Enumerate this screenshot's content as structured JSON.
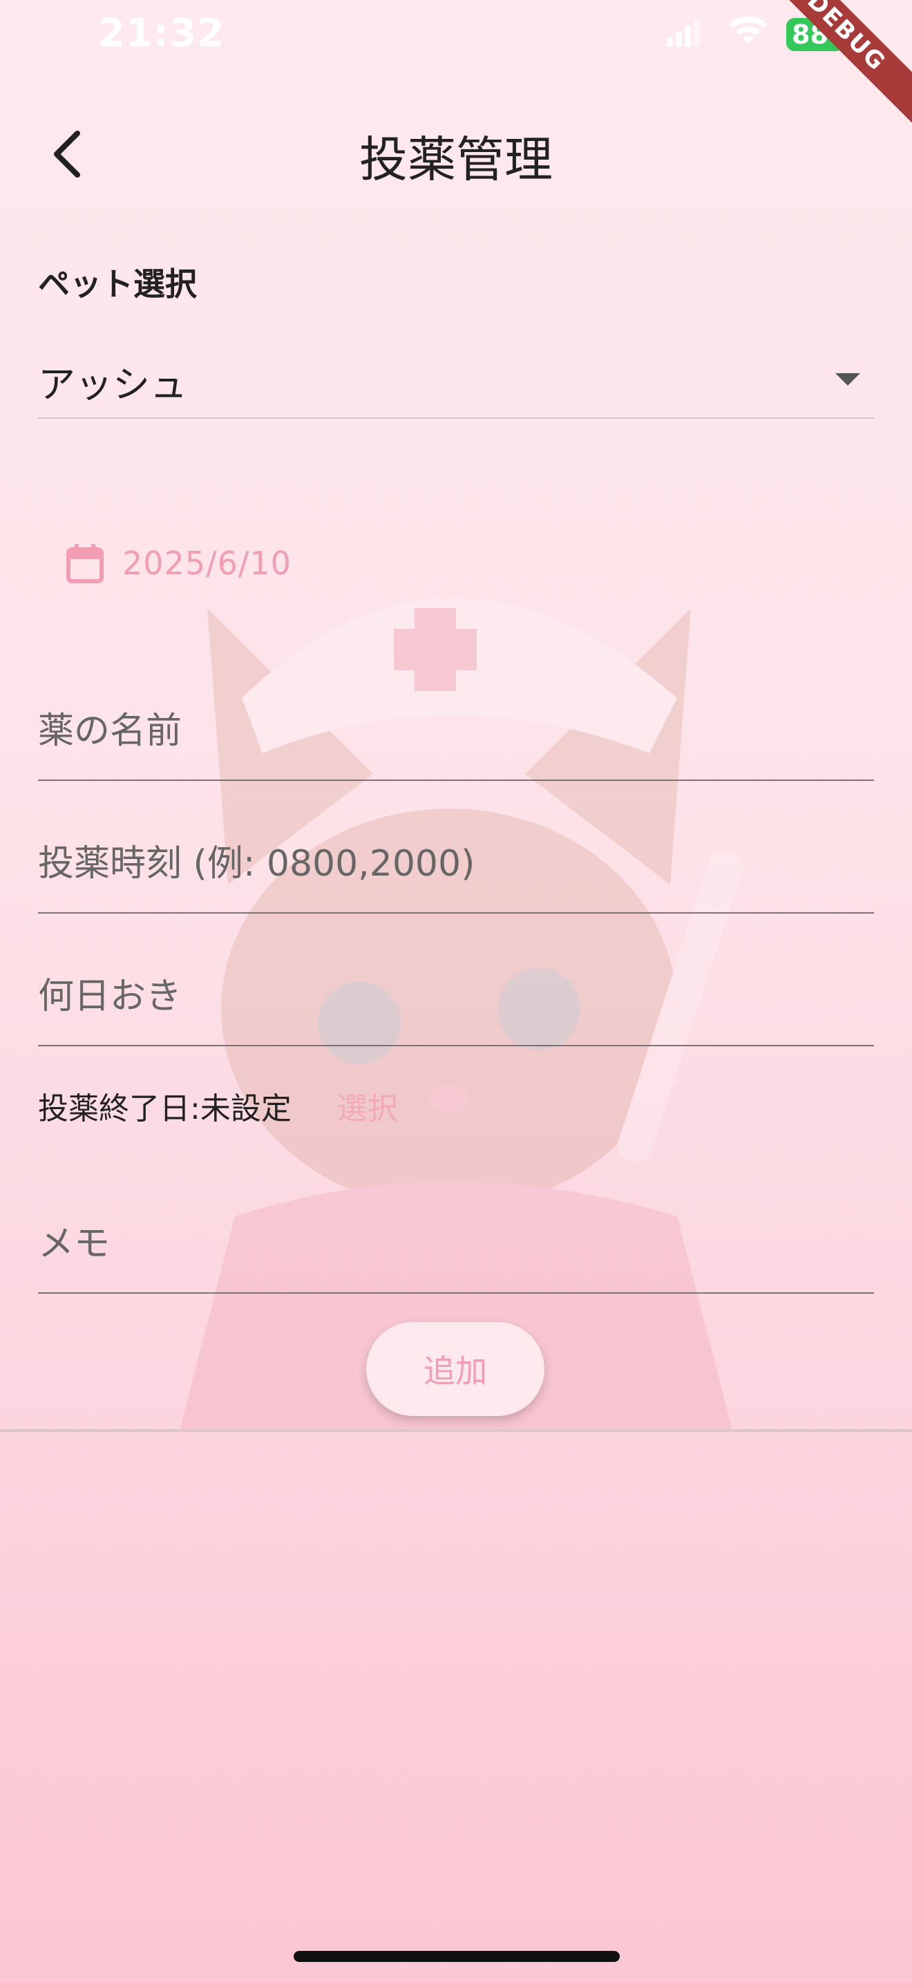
{
  "status_bar": {
    "time": "21:32",
    "battery": "88",
    "debug_banner": "DEBUG",
    "icons": [
      "signal-icon",
      "wifi-icon",
      "battery-icon"
    ]
  },
  "app_bar": {
    "title": "投薬管理",
    "back_icon": "chevron-left-icon"
  },
  "pet_select": {
    "label": "ペット選択",
    "value": "アッシュ",
    "icon": "dropdown-arrow-icon"
  },
  "date": {
    "value": "2025/6/10",
    "icon": "calendar-icon"
  },
  "fields": {
    "medicine_name": {
      "placeholder": "薬の名前",
      "value": ""
    },
    "dose_time": {
      "placeholder": "投薬時刻 (例: 0800,2000)",
      "value": ""
    },
    "interval_days": {
      "placeholder": "何日おき",
      "value": ""
    },
    "memo": {
      "placeholder": "メモ",
      "value": ""
    }
  },
  "end_date": {
    "label": "投薬終了日:未設定",
    "select_label": "選択"
  },
  "actions": {
    "add_label": "追加"
  },
  "colors": {
    "accent_pink": "#f29db3",
    "background_top": "#fde9ee",
    "background_bottom": "#fbc6d4",
    "battery_green": "#34c759",
    "debug_red": "#a83a3a"
  }
}
